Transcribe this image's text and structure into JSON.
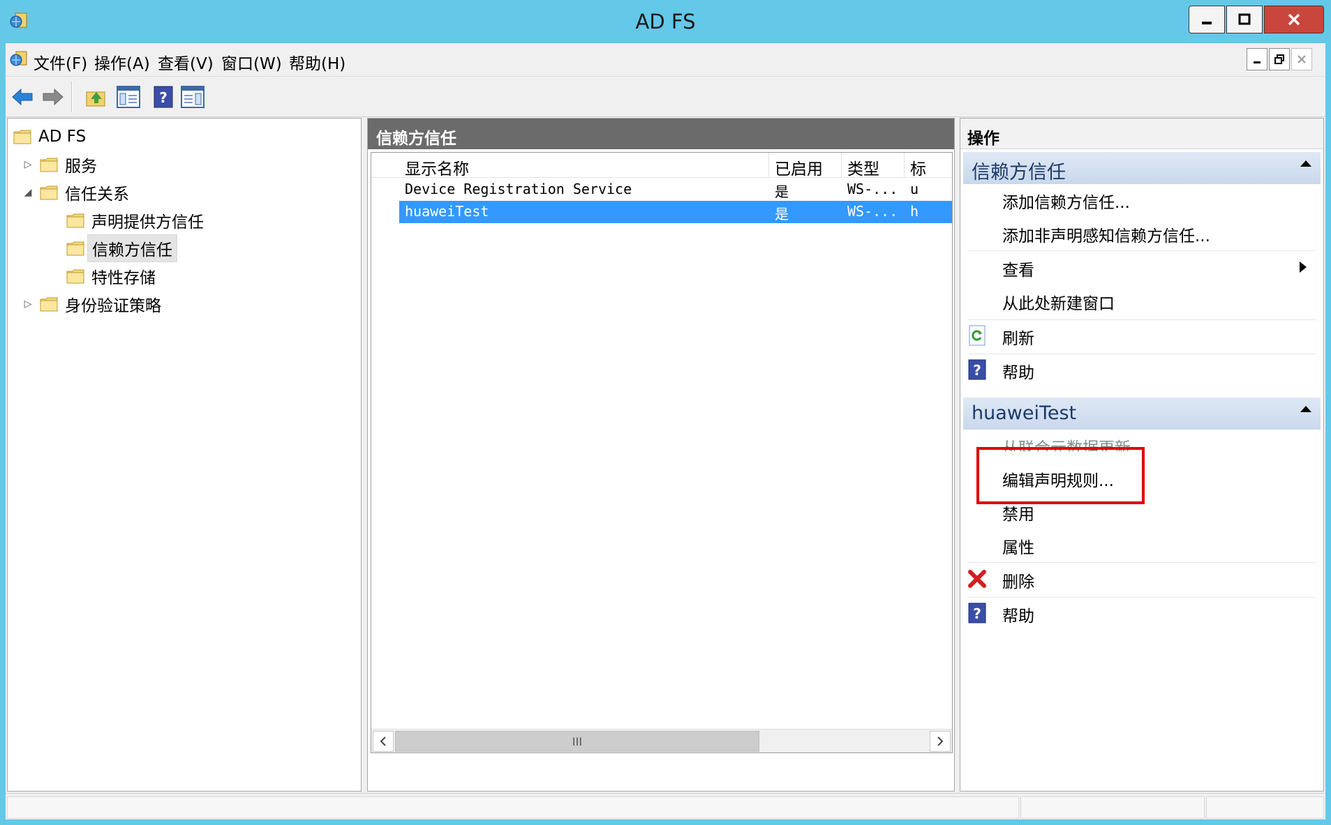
{
  "window": {
    "title": "AD FS"
  },
  "menu": {
    "items": [
      "文件(F)",
      "操作(A)",
      "查看(V)",
      "窗口(W)",
      "帮助(H)"
    ]
  },
  "tree": {
    "root": "AD FS",
    "nodes": [
      "服务",
      "信任关系",
      "声明提供方信任",
      "信赖方信任",
      "特性存储",
      "身份验证策略"
    ],
    "selected": "信赖方信任"
  },
  "center": {
    "title": "信赖方信任",
    "columns": [
      "显示名称",
      "已启用",
      "类型",
      "标"
    ],
    "rows": [
      {
        "name": "Device Registration Service",
        "enabled": "是",
        "type": "WS-...",
        "id": "u"
      },
      {
        "name": "huaweiTest",
        "enabled": "是",
        "type": "WS-...",
        "id": "h"
      }
    ],
    "selected_row": "huaweiTest",
    "scroll_thumb_glyph": "III"
  },
  "actions": {
    "title": "操作",
    "section1": {
      "title": "信赖方信任",
      "items": [
        "添加信赖方信任...",
        "添加非声明感知信赖方信任...",
        "查看",
        "从此处新建窗口",
        "刷新",
        "帮助"
      ]
    },
    "section2": {
      "title": "huaweiTest",
      "items": [
        "从联合元数据更新...",
        "编辑声明规则...",
        "禁用",
        "属性",
        "删除",
        "帮助"
      ]
    }
  },
  "colors": {
    "title_bar": "#64c8e8",
    "selection": "#3399ff",
    "highlight_box": "#e00000",
    "close_button": "#c9463c"
  }
}
